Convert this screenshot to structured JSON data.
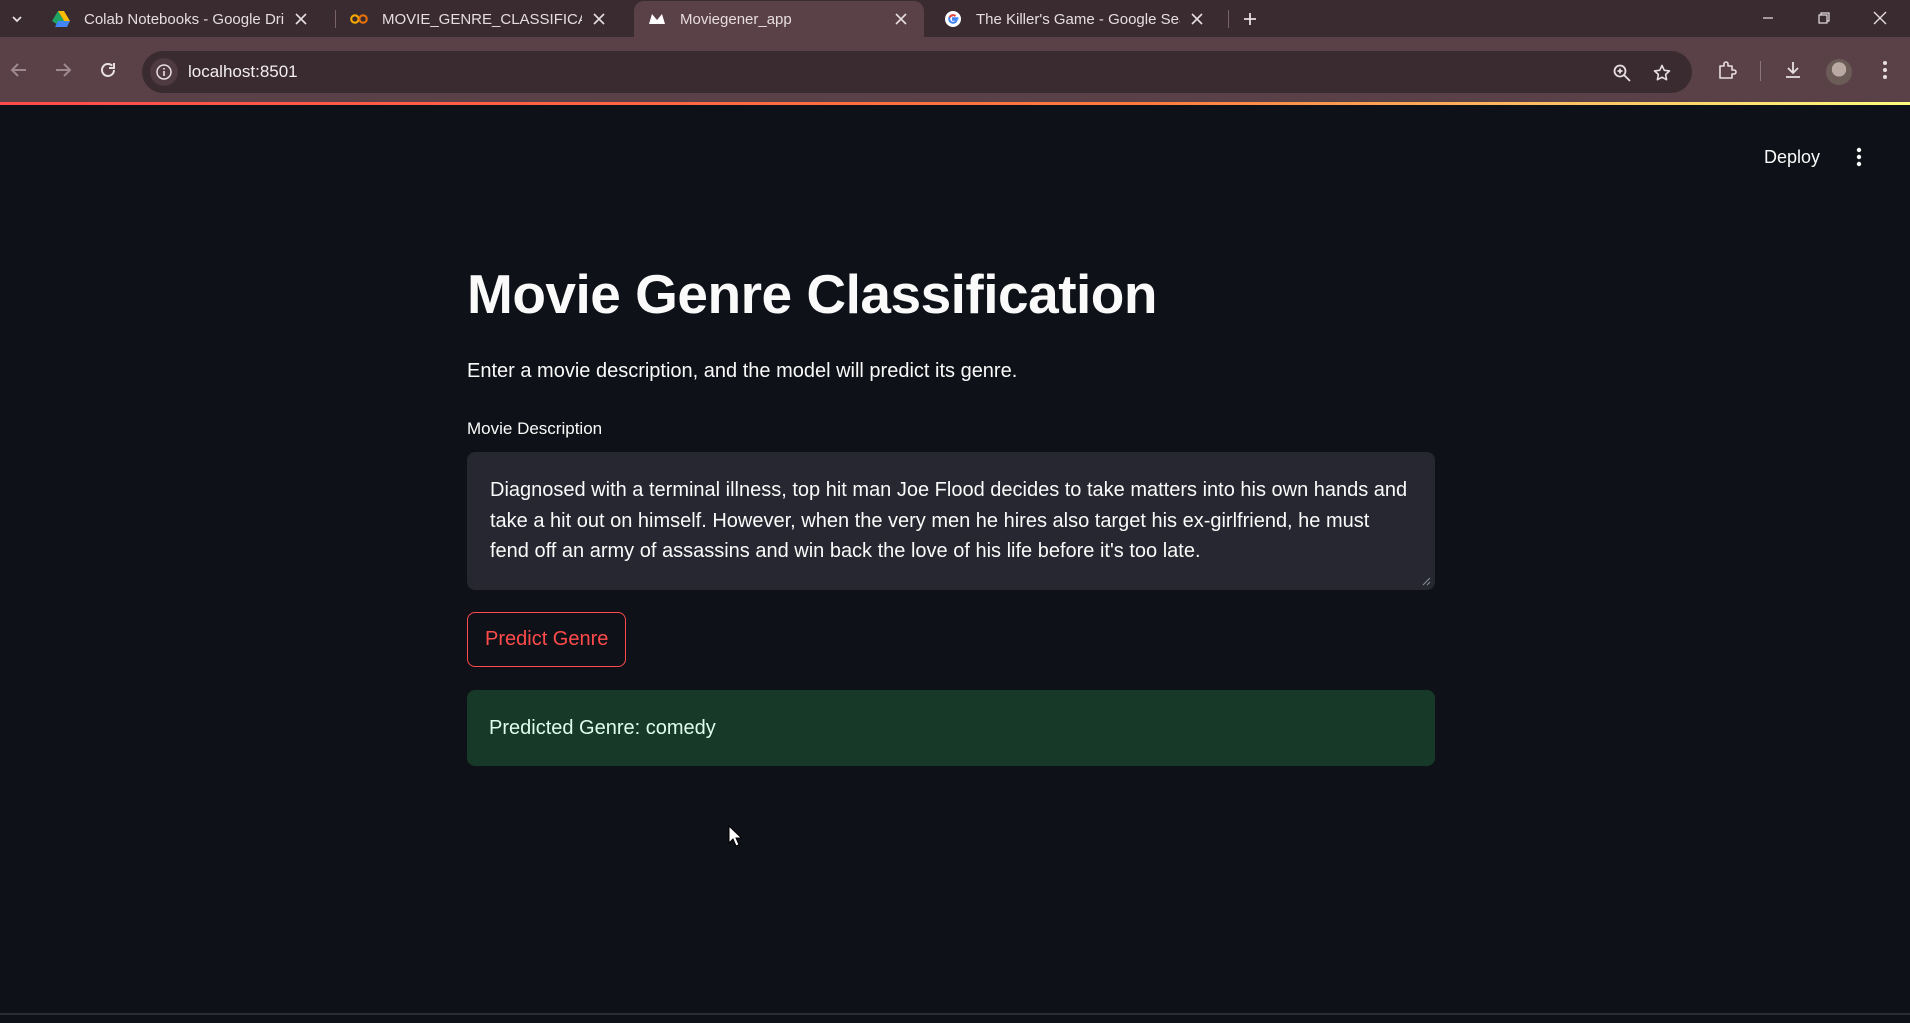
{
  "browser": {
    "tabs": [
      {
        "title": "Colab Notebooks - Google Drive",
        "icon": "google-drive-icon",
        "active": false
      },
      {
        "title": "MOVIE_GENRE_CLASSIFICATION",
        "icon": "colab-icon",
        "active": false
      },
      {
        "title": "Moviegener_app",
        "icon": "streamlit-icon",
        "active": true
      },
      {
        "title": "The Killer's Game - Google Search",
        "icon": "google-icon",
        "active": false
      }
    ],
    "url": "localhost:8501"
  },
  "app": {
    "deploy_label": "Deploy",
    "title": "Movie Genre Classification",
    "subtitle": "Enter a movie description, and the model will predict its genre.",
    "input_label": "Movie Description",
    "input_value": "Diagnosed with a terminal illness, top hit man Joe Flood decides to take matters into his own hands and take a hit out on himself. However, when the very men he hires also target his ex-girlfriend, he must fend off an army of assassins and win back the love of his life before it's too late.",
    "predict_button": "Predict Genre",
    "result": "Predicted Genre: comedy"
  },
  "colors": {
    "background": "#0e1117",
    "accent": "#ff4b4b",
    "success_bg": "#173928",
    "input_bg": "#262730",
    "browser_frame": "#5a4047"
  }
}
